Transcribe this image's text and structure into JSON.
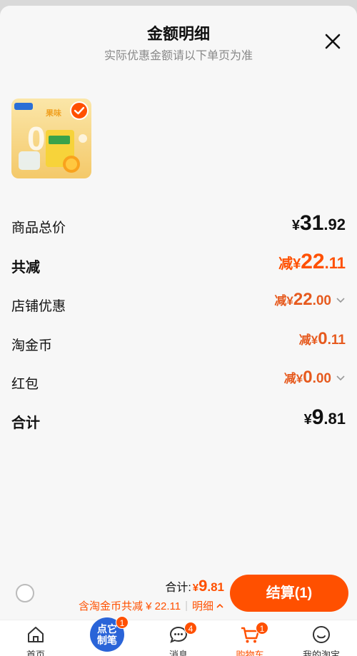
{
  "header": {
    "title": "金额明细",
    "subtitle": "实际优惠金额请以下单页为准"
  },
  "rows": {
    "subtotal": {
      "label": "商品总价",
      "cur": "¥",
      "int": "31",
      "dec": ".92"
    },
    "total_discount": {
      "label": "共减",
      "pre": "减¥",
      "int": "22",
      "dec": ".11"
    },
    "shop_discount": {
      "label": "店铺优惠",
      "pre": "减¥",
      "int": "22",
      "dec": ".00"
    },
    "coins": {
      "label": "淘金币",
      "pre": "减¥",
      "int": "0",
      "dec": ".11"
    },
    "red_packet": {
      "label": "红包",
      "pre": "减¥",
      "int": "0",
      "dec": ".00"
    },
    "total": {
      "label": "合计",
      "cur": "¥",
      "int": "9",
      "dec": ".81"
    }
  },
  "bottom": {
    "total_label": "合计:",
    "total_cur": "¥",
    "total_int": "9",
    "total_dec": ".81",
    "discount_text": "含淘金币共减 ¥ 22.11",
    "detail_label": "明细",
    "checkout_label": "结算(1)"
  },
  "tabs": [
    {
      "label": "首页",
      "icon": "home-icon"
    },
    {
      "label": "",
      "icon": "promo-icon",
      "badge": "1",
      "promo_text": "点它\n制笔"
    },
    {
      "label": "消息",
      "icon": "chat-icon",
      "badge": "4"
    },
    {
      "label": "购物车",
      "icon": "cart-icon",
      "badge": "1",
      "active": true
    },
    {
      "label": "我的淘宝",
      "icon": "profile-icon"
    }
  ],
  "colors": {
    "accent": "#ff5000",
    "background": "#f7f7f7"
  }
}
